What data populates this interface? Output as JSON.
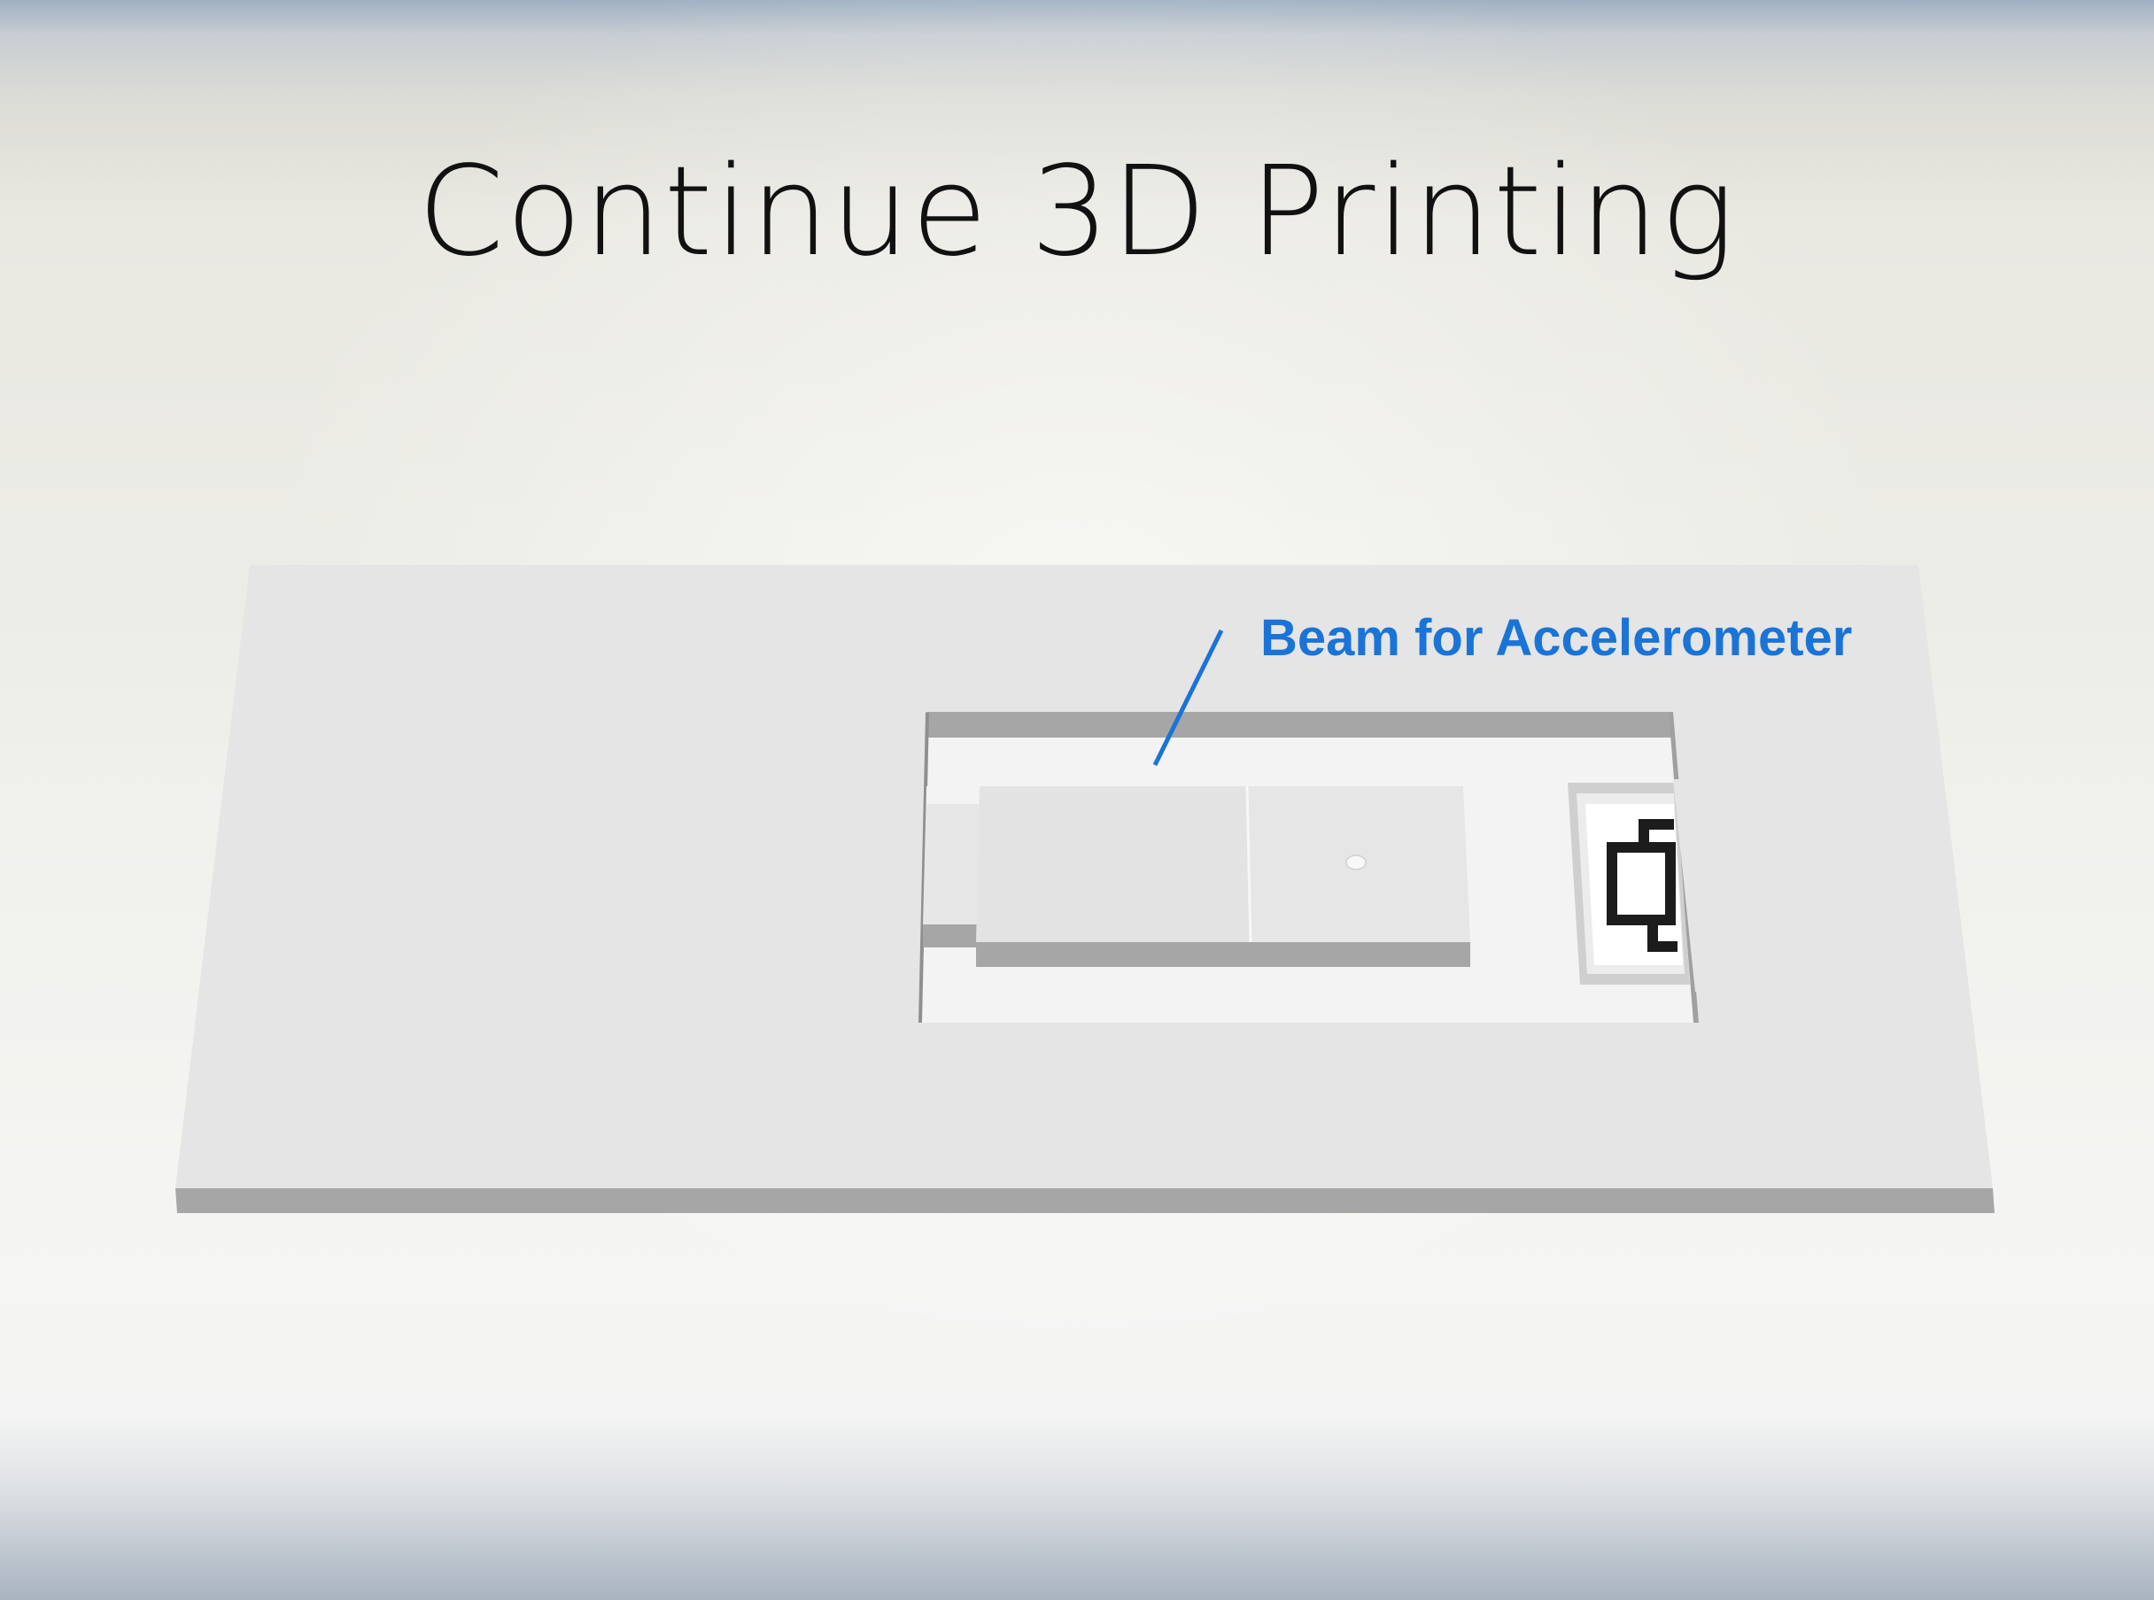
{
  "slide": {
    "title": "Continue 3D Printing"
  },
  "model": {
    "callout_label": "Beam for Accelerometer",
    "accent_color": "#1a74d8",
    "plate_color": "#e5e5e5",
    "edge_color": "#a6a6a6"
  }
}
